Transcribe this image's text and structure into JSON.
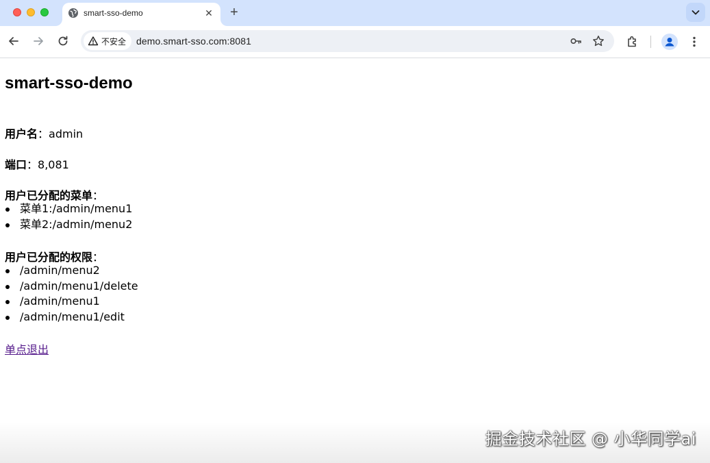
{
  "browser": {
    "tab_title": "smart-sso-demo",
    "security_label": "不安全",
    "url": "demo.smart-sso.com:8081"
  },
  "page": {
    "heading": "smart-sso-demo",
    "username_label": "用户名",
    "username_value": "admin",
    "port_label": "端口",
    "port_value": "8,081",
    "menus_label": "用户已分配的菜单",
    "menus": [
      "菜单1:/admin/menu1",
      "菜单2:/admin/menu2"
    ],
    "permissions_label": "用户已分配的权限",
    "permissions": [
      "/admin/menu2",
      "/admin/menu1/delete",
      "/admin/menu1",
      "/admin/menu1/edit"
    ],
    "logout_link": "单点退出"
  },
  "watermark": "掘金技术社区 @ 小华同学ai"
}
